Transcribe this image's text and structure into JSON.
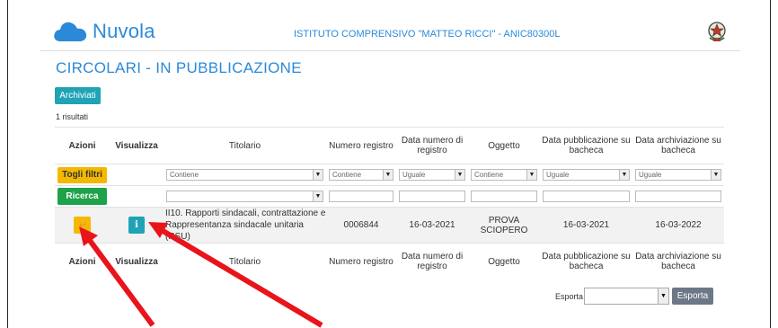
{
  "header": {
    "app_name": "Nuvola",
    "school_name": "ISTITUTO COMPRENSIVO \"MATTEO RICCI\" - ANIC80300L"
  },
  "page_title": "CIRCOLARI - IN PUBBLICAZIONE",
  "archiviati_label": "Archiviati",
  "results_text": "1 risultati",
  "columns": {
    "azioni": "Azioni",
    "visualizza": "Visualizza",
    "titolario": "Titolario",
    "numero_registro": "Numero registro",
    "data_numero": "Data numero di registro",
    "oggetto": "Oggetto",
    "data_pubblicazione": "Data pubblicazione su bacheca",
    "data_archiviazione": "Data archiviazione su bacheca"
  },
  "filters": {
    "togli_filtri": "Togli filtri",
    "ricerca": "Ricerca",
    "titolario_op": "Contiene",
    "numero_op": "Contiene",
    "data_numero_op": "Uguale",
    "oggetto_op": "Contiene",
    "data_pubb_op": "Uguale",
    "data_arch_op": "Uguale"
  },
  "row": {
    "titolario_line1": "II10. Rapporti sindacali, contrattazione e",
    "titolario_line2": "Rappresentanza sindacale unitaria (RSU)",
    "numero_registro": "0006844",
    "data_numero": "16-03-2021",
    "oggetto_line1": "PROVA",
    "oggetto_line2": "SCIOPERO",
    "data_pubblicazione": "16-03-2021",
    "data_archiviazione": "16-03-2022"
  },
  "footer": {
    "esporta_label": "Esporta",
    "esporta_button": "Esporta"
  },
  "colors": {
    "brand_blue": "#2b8ad8",
    "teal": "#1fa3b5",
    "yellow": "#f5b800",
    "green": "#1ea24a",
    "arrow_red": "#e8141c"
  },
  "icons": {
    "logo": "cloud-icon",
    "emblem": "italian-republic-emblem-icon",
    "action": "hand-pointer-icon",
    "view": "info-icon"
  }
}
